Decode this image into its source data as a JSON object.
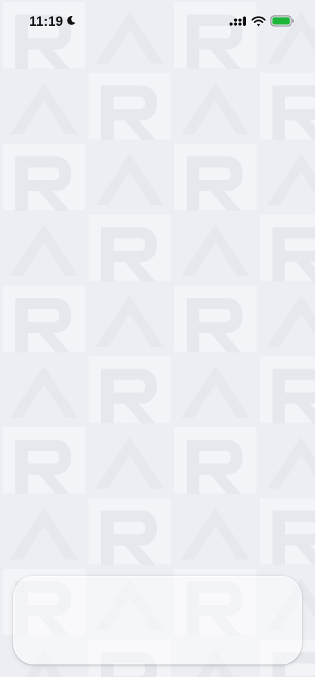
{
  "status_bar": {
    "time": "11:19",
    "focus_icon": "crescent-moon-icon",
    "signal_icon": "cellular-signal-icon",
    "wifi_icon": "wifi-icon",
    "battery_icon": "battery-icon",
    "battery_color": "#1fb53a"
  },
  "background": {
    "pattern_letters": [
      "R",
      "A"
    ],
    "base_color": "#eceef3",
    "tile_color": "#f3f4f8",
    "glyph_color": "#e6e8ee"
  },
  "bottom_panel": {
    "background_color": "#f7f7fa"
  }
}
